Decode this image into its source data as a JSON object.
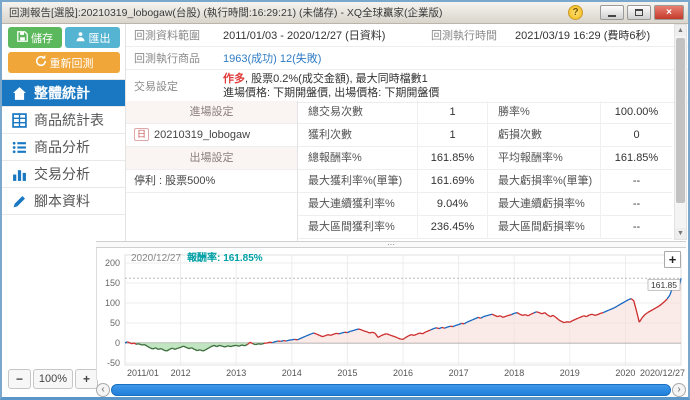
{
  "window": {
    "title": "回測報告[選股]:20210319_lobogaw(台股) (執行時間:16:29:21) (未儲存) - XQ全球贏家(企業版)",
    "help_glyph": "?",
    "close_glyph": "×"
  },
  "icons": {
    "up": "▲",
    "down": "▼",
    "left": "‹",
    "right": "›",
    "dots": "···"
  },
  "sidebar": {
    "save_label": "儲存",
    "export_label": "匯出",
    "rerun_label": "重新回測",
    "nav": [
      {
        "label": "整體統計",
        "active": true
      },
      {
        "label": "商品統計表",
        "active": false
      },
      {
        "label": "商品分析",
        "active": false
      },
      {
        "label": "交易分析",
        "active": false
      },
      {
        "label": "腳本資料",
        "active": false
      }
    ],
    "zoom": {
      "minus": "−",
      "level": "100%",
      "plus": "+"
    }
  },
  "info": {
    "range_label": "回測資料範圍",
    "range_value": "2011/01/03 - 2020/12/27 (日資料)",
    "time_label": "回測執行時間",
    "time_value": "2021/03/19 16:29 (費時6秒)",
    "symbols_label": "回測執行商品",
    "symbols_value": "1963(成功) 12(失敗)",
    "trade_label": "交易設定",
    "trade_side": "作多",
    "trade_rest": ", 股票0.2%(成交金額), 最大同時檔數1",
    "trade_line2": "進場價格: 下期開盤價, 出場價格: 下期開盤價"
  },
  "settings": {
    "entry_header": "進場設定",
    "entry_badge": "日",
    "entry_name": "20210319_lobogaw",
    "exit_header": "出場設定",
    "exit_value": "停利 : 股票500%"
  },
  "stats": {
    "rows": [
      {
        "l1": "總交易次數",
        "v1": "1",
        "l2": "勝率%",
        "v2": "100.00%"
      },
      {
        "l1": "獲利次數",
        "v1": "1",
        "l2": "虧損次數",
        "v2": "0"
      },
      {
        "l1": "總報酬率%",
        "v1": "161.85%",
        "l2": "平均報酬率%",
        "v2": "161.85%"
      },
      {
        "l1": "最大獲利率%(單筆)",
        "v1": "161.69%",
        "l2": "最大虧損率%(單筆)",
        "v2": "--"
      },
      {
        "l1": "最大連續獲利率%",
        "v1": "9.04%",
        "l2": "最大連續虧損率%",
        "v2": "--"
      },
      {
        "l1": "最大區間獲利率%",
        "v1": "236.45%",
        "l2": "最大區間虧損率%",
        "v2": "--"
      }
    ]
  },
  "chart_data": {
    "type": "line",
    "header": {
      "date": "2020/12/27",
      "label": "報酬率:",
      "value": "161.85%"
    },
    "end_label": "161.85",
    "final_value": 161.85,
    "ylabel": "報酬率%",
    "ylim": [
      -55,
      222
    ],
    "y_ticks": [
      200,
      150,
      100,
      50,
      0,
      -50
    ],
    "x_ticks": [
      "2011/01",
      "2012",
      "2013",
      "2014",
      "2015",
      "2016",
      "2017",
      "2018",
      "2019",
      "2020",
      "2020/12/27"
    ],
    "x_tick_positions": [
      2011,
      2012,
      2013,
      2014,
      2015,
      2016,
      2017,
      2018,
      2019,
      2020,
      2021
    ],
    "legend": "off",
    "grid": "on",
    "series": [
      {
        "name": "報酬率%",
        "points": [
          [
            2011.0,
            0
          ],
          [
            2011.04,
            3
          ],
          [
            2011.08,
            1
          ],
          [
            2011.12,
            -2
          ],
          [
            2011.16,
            0
          ],
          [
            2011.2,
            -3
          ],
          [
            2011.25,
            -2
          ],
          [
            2011.3,
            -5
          ],
          [
            2011.35,
            -4
          ],
          [
            2011.4,
            -8
          ],
          [
            2011.45,
            -12
          ],
          [
            2011.5,
            -15
          ],
          [
            2011.55,
            -12
          ],
          [
            2011.6,
            -16
          ],
          [
            2011.65,
            -14
          ],
          [
            2011.7,
            -18
          ],
          [
            2011.75,
            -20
          ],
          [
            2011.8,
            -16
          ],
          [
            2011.85,
            -13
          ],
          [
            2011.9,
            -16
          ],
          [
            2011.95,
            -13
          ],
          [
            2012.0,
            -11
          ],
          [
            2012.05,
            -8
          ],
          [
            2012.1,
            -11
          ],
          [
            2012.15,
            -14
          ],
          [
            2012.2,
            -12
          ],
          [
            2012.25,
            -16
          ],
          [
            2012.3,
            -19
          ],
          [
            2012.35,
            -17
          ],
          [
            2012.4,
            -20
          ],
          [
            2012.45,
            -17
          ],
          [
            2012.5,
            -13
          ],
          [
            2012.55,
            -9
          ],
          [
            2012.6,
            -6
          ],
          [
            2012.65,
            -9
          ],
          [
            2012.7,
            -6
          ],
          [
            2012.75,
            -8
          ],
          [
            2012.8,
            -10
          ],
          [
            2012.85,
            -7
          ],
          [
            2012.9,
            -9
          ],
          [
            2012.95,
            -7
          ],
          [
            2013.0,
            -6
          ],
          [
            2013.05,
            -8
          ],
          [
            2013.1,
            -5
          ],
          [
            2013.15,
            -7
          ],
          [
            2013.2,
            -4
          ],
          [
            2013.25,
            2
          ],
          [
            2013.3,
            -2
          ],
          [
            2013.35,
            -4
          ],
          [
            2013.4,
            -2
          ],
          [
            2013.45,
            -3
          ],
          [
            2013.5,
            -1
          ],
          [
            2013.55,
            0
          ],
          [
            2013.6,
            2
          ],
          [
            2013.65,
            1
          ],
          [
            2013.7,
            3
          ],
          [
            2013.75,
            5
          ],
          [
            2013.8,
            4
          ],
          [
            2013.85,
            6
          ],
          [
            2013.9,
            5
          ],
          [
            2013.95,
            7
          ],
          [
            2014.0,
            8
          ],
          [
            2014.05,
            9
          ],
          [
            2014.1,
            8
          ],
          [
            2014.15,
            11
          ],
          [
            2014.2,
            14
          ],
          [
            2014.25,
            17
          ],
          [
            2014.3,
            20
          ],
          [
            2014.35,
            23
          ],
          [
            2014.4,
            25
          ],
          [
            2014.45,
            22
          ],
          [
            2014.5,
            19
          ],
          [
            2014.55,
            16
          ],
          [
            2014.6,
            18
          ],
          [
            2014.65,
            21
          ],
          [
            2014.7,
            19
          ],
          [
            2014.75,
            22
          ],
          [
            2014.8,
            24
          ],
          [
            2014.85,
            23
          ],
          [
            2014.9,
            25
          ],
          [
            2014.95,
            27
          ],
          [
            2015.0,
            26
          ],
          [
            2015.05,
            29
          ],
          [
            2015.1,
            31
          ],
          [
            2015.15,
            33
          ],
          [
            2015.2,
            35
          ],
          [
            2015.25,
            33
          ],
          [
            2015.3,
            30
          ],
          [
            2015.35,
            28
          ],
          [
            2015.4,
            25
          ],
          [
            2015.45,
            27
          ],
          [
            2015.5,
            24
          ],
          [
            2015.55,
            14
          ],
          [
            2015.6,
            18
          ],
          [
            2015.65,
            21
          ],
          [
            2015.7,
            23
          ],
          [
            2015.75,
            21
          ],
          [
            2015.8,
            18
          ],
          [
            2015.85,
            16
          ],
          [
            2015.9,
            13
          ],
          [
            2015.95,
            10
          ],
          [
            2016.0,
            9
          ],
          [
            2016.05,
            14
          ],
          [
            2016.1,
            18
          ],
          [
            2016.15,
            21
          ],
          [
            2016.2,
            19
          ],
          [
            2016.25,
            22
          ],
          [
            2016.3,
            25
          ],
          [
            2016.35,
            23
          ],
          [
            2016.4,
            27
          ],
          [
            2016.45,
            30
          ],
          [
            2016.5,
            33
          ],
          [
            2016.55,
            36
          ],
          [
            2016.6,
            38
          ],
          [
            2016.65,
            36
          ],
          [
            2016.7,
            39
          ],
          [
            2016.75,
            37
          ],
          [
            2016.8,
            40
          ],
          [
            2016.85,
            42
          ],
          [
            2016.9,
            41
          ],
          [
            2016.95,
            44
          ],
          [
            2017.0,
            46
          ],
          [
            2017.05,
            49
          ],
          [
            2017.1,
            48
          ],
          [
            2017.15,
            52
          ],
          [
            2017.2,
            55
          ],
          [
            2017.25,
            58
          ],
          [
            2017.3,
            61
          ],
          [
            2017.35,
            64
          ],
          [
            2017.4,
            62
          ],
          [
            2017.45,
            66
          ],
          [
            2017.5,
            68
          ],
          [
            2017.55,
            70
          ],
          [
            2017.6,
            72
          ],
          [
            2017.65,
            69
          ],
          [
            2017.7,
            66
          ],
          [
            2017.75,
            68
          ],
          [
            2017.8,
            64
          ],
          [
            2017.85,
            67
          ],
          [
            2017.9,
            69
          ],
          [
            2017.95,
            71
          ],
          [
            2018.0,
            74
          ],
          [
            2018.05,
            76
          ],
          [
            2018.1,
            72
          ],
          [
            2018.15,
            69
          ],
          [
            2018.2,
            71
          ],
          [
            2018.25,
            68
          ],
          [
            2018.3,
            72
          ],
          [
            2018.35,
            75
          ],
          [
            2018.4,
            78
          ],
          [
            2018.45,
            76
          ],
          [
            2018.5,
            73
          ],
          [
            2018.55,
            76
          ],
          [
            2018.6,
            70
          ],
          [
            2018.65,
            66
          ],
          [
            2018.7,
            69
          ],
          [
            2018.75,
            64
          ],
          [
            2018.8,
            58
          ],
          [
            2018.85,
            54
          ],
          [
            2018.9,
            51
          ],
          [
            2018.95,
            53
          ],
          [
            2019.0,
            52
          ],
          [
            2019.05,
            56
          ],
          [
            2019.1,
            59
          ],
          [
            2019.15,
            62
          ],
          [
            2019.2,
            65
          ],
          [
            2019.25,
            68
          ],
          [
            2019.3,
            66
          ],
          [
            2019.35,
            70
          ],
          [
            2019.4,
            72
          ],
          [
            2019.45,
            69
          ],
          [
            2019.5,
            71
          ],
          [
            2019.55,
            74
          ],
          [
            2019.6,
            76
          ],
          [
            2019.65,
            79
          ],
          [
            2019.7,
            82
          ],
          [
            2019.75,
            85
          ],
          [
            2019.8,
            88
          ],
          [
            2019.85,
            92
          ],
          [
            2019.9,
            96
          ],
          [
            2019.95,
            100
          ],
          [
            2020.0,
            104
          ],
          [
            2020.05,
            108
          ],
          [
            2020.1,
            111
          ],
          [
            2020.15,
            106
          ],
          [
            2020.2,
            80
          ],
          [
            2020.25,
            52
          ],
          [
            2020.3,
            63
          ],
          [
            2020.35,
            71
          ],
          [
            2020.4,
            76
          ],
          [
            2020.45,
            80
          ],
          [
            2020.5,
            84
          ],
          [
            2020.55,
            88
          ],
          [
            2020.6,
            92
          ],
          [
            2020.65,
            97
          ],
          [
            2020.7,
            103
          ],
          [
            2020.75,
            110
          ],
          [
            2020.8,
            120
          ],
          [
            2020.82,
            128
          ],
          [
            2020.84,
            135
          ],
          [
            2020.86,
            140
          ],
          [
            2020.88,
            134
          ],
          [
            2020.9,
            142
          ],
          [
            2020.92,
            137
          ],
          [
            2020.94,
            146
          ],
          [
            2020.96,
            152
          ],
          [
            2020.98,
            148
          ],
          [
            2021.0,
            161.85
          ]
        ]
      }
    ],
    "colors": {
      "new_high": "#1565c0",
      "drawdown": "#cc2a2a",
      "below_zero_line": "#3a6b3a",
      "pos_fill": "#f7ddd9",
      "neg_fill": "#b9e2b9",
      "target_line": "#bbbbbb"
    }
  },
  "colors": {
    "nav_active": "#1a78c2",
    "save_green": "#5cb85c",
    "export_blue": "#56b4d3",
    "rerun_orange": "#f0a638",
    "value_red": "#e03c3c",
    "link_blue": "#2f7cc4",
    "teal": "#00a0a5",
    "scrollbar_blue": "#1f7fd9"
  }
}
